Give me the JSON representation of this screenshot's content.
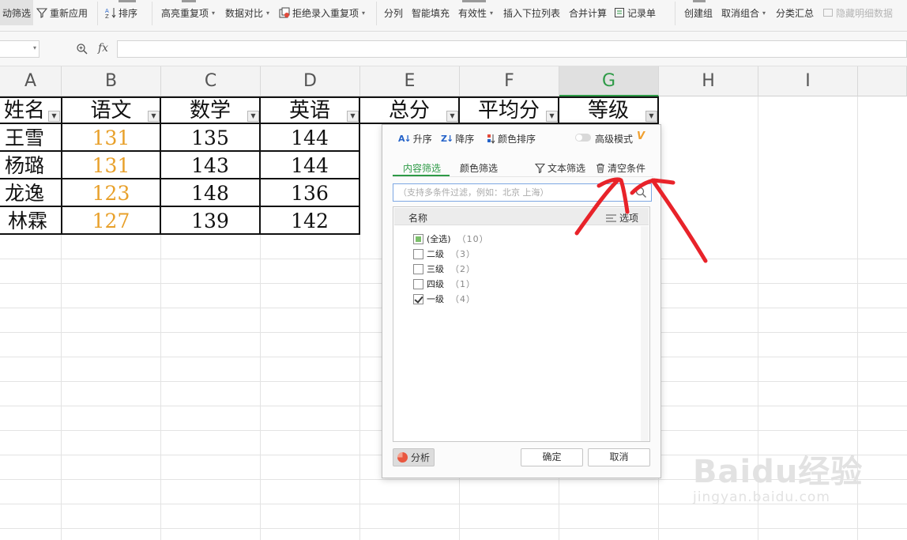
{
  "ribbon": {
    "items": [
      {
        "label": "动筛选",
        "icon": "filter-icon"
      },
      {
        "label": "重新应用",
        "icon": "reapply-filter-icon"
      },
      {
        "label": "排序",
        "icon": "sort-az-icon"
      },
      {
        "label": "高亮重复项",
        "icon": "highlight-duplicates-icon"
      },
      {
        "label": "数据对比",
        "icon": "data-compare-icon"
      },
      {
        "label": "拒绝录入重复项",
        "icon": "reject-duplicates-icon"
      },
      {
        "label": "分列",
        "icon": "split-column-icon"
      },
      {
        "label": "智能填充",
        "icon": "smart-fill-icon"
      },
      {
        "label": "有效性",
        "icon": "validation-icon"
      },
      {
        "label": "插入下拉列表",
        "icon": "dropdown-list-icon"
      },
      {
        "label": "合并计算",
        "icon": "consolidate-icon"
      },
      {
        "label": "记录单",
        "icon": "record-form-icon"
      },
      {
        "label": "创建组",
        "icon": "group-icon"
      },
      {
        "label": "取消组合",
        "icon": "ungroup-icon"
      },
      {
        "label": "分类汇总",
        "icon": "subtotal-icon"
      },
      {
        "label": "隐藏明细数据",
        "icon": "hide-detail-icon"
      }
    ]
  },
  "formula_bar": {
    "fx_label": "fx",
    "value": ""
  },
  "columns": [
    "A",
    "B",
    "C",
    "D",
    "E",
    "F",
    "G",
    "H",
    "I"
  ],
  "table": {
    "headers": [
      "姓名",
      "语文",
      "数学",
      "英语",
      "总分",
      "平均分",
      "等级"
    ],
    "rows": [
      [
        "王雪",
        "131",
        "135",
        "144"
      ],
      [
        "杨璐",
        "131",
        "143",
        "144"
      ],
      [
        "龙逸",
        "123",
        "148",
        "136"
      ],
      [
        "林霖",
        "127",
        "139",
        "142"
      ]
    ]
  },
  "filter_panel": {
    "sort_asc": "升序",
    "sort_desc": "降序",
    "color_sort": "颜色排序",
    "advanced_mode": "高级模式",
    "tab_content": "内容筛选",
    "tab_color": "颜色筛选",
    "text_filter": "文本筛选",
    "clear_conditions": "清空条件",
    "search_placeholder": "（支持多条件过滤，例如：北京 上海）",
    "list_header": "名称",
    "options_label": "选项",
    "items": [
      {
        "label": "(全选)",
        "count": "（10）",
        "state": "partial"
      },
      {
        "label": "二级",
        "count": "（3）",
        "state": "unchecked"
      },
      {
        "label": "三级",
        "count": "（2）",
        "state": "unchecked"
      },
      {
        "label": "四级",
        "count": "（1）",
        "state": "unchecked"
      },
      {
        "label": "一级",
        "count": "（4）",
        "state": "checked"
      }
    ],
    "analyze": "分析",
    "ok": "确定",
    "cancel": "取消"
  },
  "watermark": {
    "brand": "Baidu经验",
    "url": "jingyan.baidu.com"
  },
  "colors": {
    "accent_green": "#2d9a46",
    "score_orange": "#e8a02a",
    "annotation_red": "#e8232a"
  }
}
